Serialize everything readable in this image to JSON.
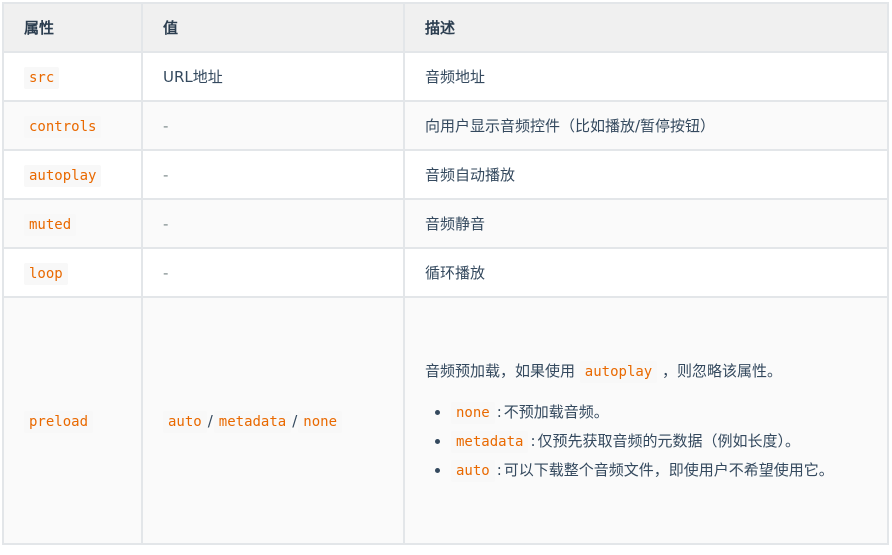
{
  "table": {
    "headers": [
      "属性",
      "值",
      "描述"
    ],
    "rows": [
      {
        "attr": "src",
        "value": "URL地址",
        "value_is_code": false,
        "desc": "音频地址"
      },
      {
        "attr": "controls",
        "value": "-",
        "value_is_code": false,
        "desc": "向用户显示音频控件（比如播放/暂停按钮）"
      },
      {
        "attr": "autoplay",
        "value": "-",
        "value_is_code": false,
        "desc": "音频自动播放"
      },
      {
        "attr": "muted",
        "value": "-",
        "value_is_code": false,
        "desc": "音频静音"
      },
      {
        "attr": "loop",
        "value": "-",
        "value_is_code": false,
        "desc": "循环播放"
      }
    ],
    "preload_row": {
      "attr": "preload",
      "values": [
        "auto",
        "metadata",
        "none"
      ],
      "separator": "/",
      "desc_intro_before": "音频预加载，如果使用",
      "desc_intro_code": "autoplay",
      "desc_intro_after": "，则忽略该属性。",
      "options": [
        {
          "code": "none",
          "text": "不预加载音频。"
        },
        {
          "code": "metadata",
          "text": "仅预先获取音频的元数据（例如长度）。"
        },
        {
          "code": "auto",
          "text": "可以下载整个音频文件，即使用户不希望使用它。"
        }
      ],
      "colon": ":"
    }
  },
  "colors": {
    "code_text": "#e96900",
    "body_text": "#34495e",
    "header_bg": "#f0f0f0",
    "stripe_bg": "#fafafa",
    "border": "#e3e6e9"
  }
}
